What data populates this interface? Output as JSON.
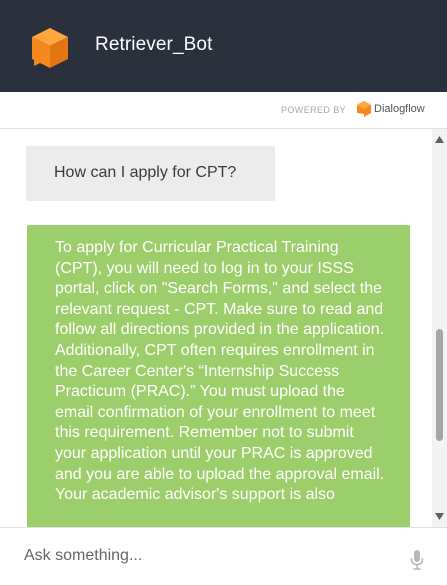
{
  "header": {
    "title": "Retriever_Bot",
    "logo_icon": "cube-logo-icon",
    "background_color": "#2b303d"
  },
  "powered_by": {
    "label": "POWERED BY",
    "brand": "Dialogflow",
    "brand_icon": "dialogflow-icon"
  },
  "messages": [
    {
      "role": "user",
      "text": "How can I apply for CPT?"
    },
    {
      "role": "bot",
      "text": "To apply for Curricular Practical Training (CPT), you will need to log in to your ISSS portal, click on \"Search Forms,\" and select the relevant request - CPT. Make sure to read and follow all directions provided in the application. Additionally, CPT often requires enrollment in the Career Center's “Internship Success Practicum (PRAC).” You must upload the email confirmation of your enrollment to meet this requirement. Remember not to submit your application until your PRAC is approved and you are able to upload the approval email. Your academic advisor's support is also"
    }
  ],
  "colors": {
    "user_bubble": "#ececec",
    "bot_bubble": "#9cce6b",
    "accent_orange": "#f5891f"
  },
  "input": {
    "placeholder": "Ask something...",
    "value": "",
    "mic_icon": "microphone-icon"
  }
}
